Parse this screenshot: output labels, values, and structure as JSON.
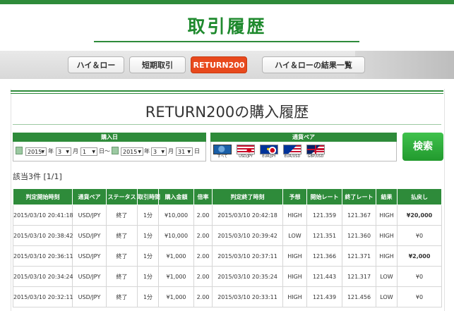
{
  "header": {
    "title": "取引履歴"
  },
  "tabs": [
    {
      "label": "ハイ＆ロー",
      "active": false
    },
    {
      "label": "短期取引",
      "active": false
    },
    {
      "label": "RETURN200",
      "active": true
    },
    {
      "label": "ハイ＆ローの結果一覧",
      "active": false
    }
  ],
  "section": {
    "title": "RETURN200の購入履歴"
  },
  "filter": {
    "date_label": "購入日",
    "from": {
      "year": "2015",
      "month": "3",
      "day": "1"
    },
    "to": {
      "year": "2015",
      "month": "3",
      "day": "31"
    },
    "units": {
      "year": "年",
      "month": "月",
      "day": "日",
      "range": "日～"
    },
    "pair_label": "通貨ペア",
    "pairs": [
      {
        "label": "すべて",
        "icon": "globe-icon",
        "selected": true
      },
      {
        "label": "USD/JPY",
        "icon": "us-jp-flag-icon"
      },
      {
        "label": "EUR/JPY",
        "icon": "eu-jp-flag-icon"
      },
      {
        "label": "EUR/USD",
        "icon": "eu-us-flag-icon"
      },
      {
        "label": "GBP/USD",
        "icon": "gb-us-flag-icon"
      }
    ],
    "search_label": "検索"
  },
  "result_count": "該当3件 [1/1]",
  "table": {
    "headers": [
      "判定開始時刻",
      "通貨ペア",
      "ステータス",
      "取引時間",
      "購入金額",
      "倍率",
      "判定終了時刻",
      "予想",
      "開始レート",
      "終了レート",
      "結果",
      "払戻し"
    ],
    "rows": [
      [
        "2015/03/10 20:41:18",
        "USD/JPY",
        "終了",
        "1分",
        "¥10,000",
        "2.00",
        "2015/03/10 20:42:18",
        "HIGH",
        "121.359",
        "121.367",
        "HIGH",
        "¥20,000"
      ],
      [
        "2015/03/10 20:38:42",
        "USD/JPY",
        "終了",
        "1分",
        "¥10,000",
        "2.00",
        "2015/03/10 20:39:42",
        "LOW",
        "121.351",
        "121.360",
        "HIGH",
        "¥0"
      ],
      [
        "2015/03/10 20:36:11",
        "USD/JPY",
        "終了",
        "1分",
        "¥1,000",
        "2.00",
        "2015/03/10 20:37:11",
        "HIGH",
        "121.366",
        "121.371",
        "HIGH",
        "¥2,000"
      ],
      [
        "2015/03/10 20:34:24",
        "USD/JPY",
        "終了",
        "1分",
        "¥1,000",
        "2.00",
        "2015/03/10 20:35:24",
        "HIGH",
        "121.443",
        "121.317",
        "LOW",
        "¥0"
      ],
      [
        "2015/03/10 20:32:11",
        "USD/JPY",
        "終了",
        "1分",
        "¥1,000",
        "2.00",
        "2015/03/10 20:33:11",
        "HIGH",
        "121.439",
        "121.456",
        "LOW",
        "¥0"
      ]
    ]
  },
  "colors": {
    "brand_green": "#2e8b3a",
    "active_tab": "#e8491d",
    "high": "#e51c1c",
    "low": "#1c3fe5"
  }
}
